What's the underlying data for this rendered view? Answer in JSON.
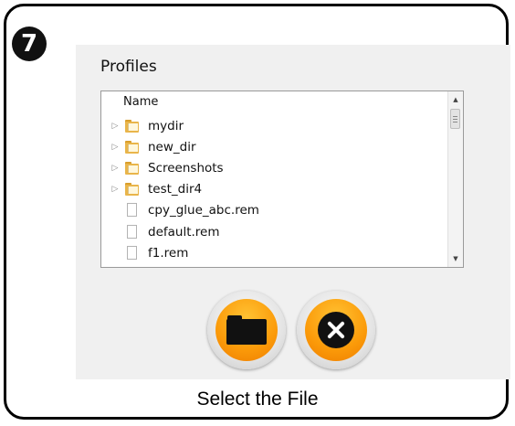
{
  "step": {
    "number": "7"
  },
  "dialog": {
    "title": "Profiles",
    "column_header": "Name",
    "items": [
      {
        "name": "mydir",
        "type": "folder",
        "icon": "folder-icon",
        "expandable": true
      },
      {
        "name": "new_dir",
        "type": "folder",
        "icon": "folder-icon",
        "expandable": true
      },
      {
        "name": "Screenshots",
        "type": "folder",
        "icon": "folder-icon",
        "expandable": true
      },
      {
        "name": "test_dir4",
        "type": "folder",
        "icon": "folder-icon",
        "expandable": true
      },
      {
        "name": "cpy_glue_abc.rem",
        "type": "file",
        "icon": "file-icon",
        "expandable": false
      },
      {
        "name": "default.rem",
        "type": "file",
        "icon": "file-icon",
        "expandable": false
      },
      {
        "name": "f1.rem",
        "type": "file",
        "icon": "file-icon",
        "expandable": false
      }
    ],
    "buttons": [
      {
        "name": "browse-folder-button",
        "icon": "folder-icon"
      },
      {
        "name": "cancel-button",
        "icon": "close-icon"
      }
    ]
  },
  "caption": "Select the File",
  "colors": {
    "accent": "#fb9a09",
    "dialog_bg": "#f0f0f0",
    "frame": "#000000"
  }
}
